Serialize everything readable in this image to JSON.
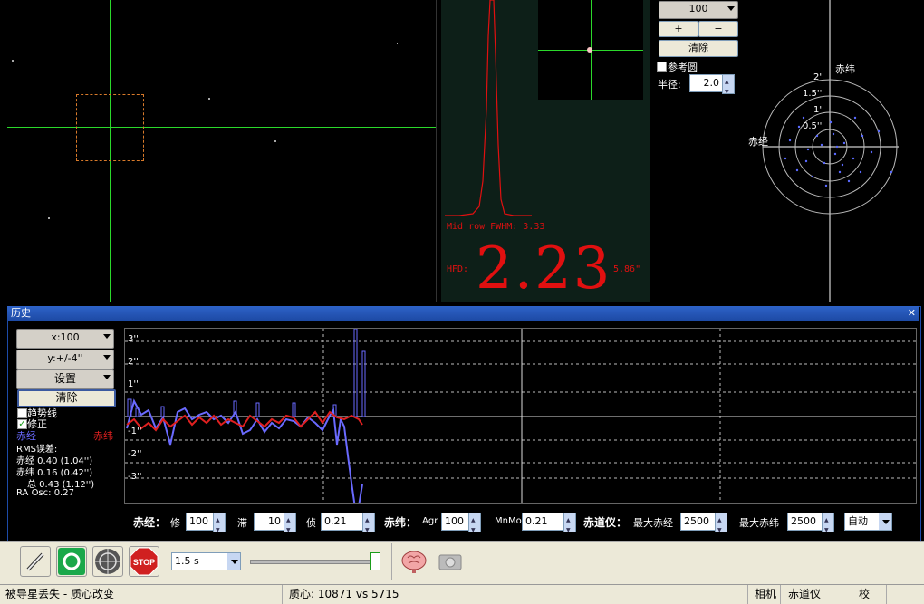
{
  "profile": {
    "fwhm_text": "Mid row FWHM: 3.33",
    "hfd_label": "HFD:",
    "hfd_value": "2.23",
    "hfd_arcsec": "5.86\""
  },
  "scatter": {
    "zoom_value": "100",
    "plus_label": "+",
    "minus_label": "−",
    "clear_label": "清除",
    "ref_circle_label": "参考圆",
    "radius_label": "半径:",
    "radius_value": "2.0",
    "axis_dec": "赤纬",
    "axis_ra": "赤经",
    "ring_labels": [
      "2''",
      "1.5''",
      "1''",
      "0.5''"
    ]
  },
  "history": {
    "title": "历史",
    "x_scale": "x:100",
    "y_scale": "y:+/-4''",
    "settings_label": "设置",
    "clear_label": "清除",
    "trendline_label": "趋势线",
    "correction_label": "修正",
    "ra_legend": "赤经",
    "dec_legend": "赤纬",
    "rms_title": "RMS误差:",
    "rms_ra": "赤经 0.40 (1.04'')",
    "rms_dec": "赤纬 0.16 (0.42'')",
    "rms_total": "总 0.43 (1.12'')",
    "ra_osc": "RA Osc: 0.27",
    "y_ticks": [
      "3''",
      "2''",
      "1''",
      "-1''",
      "-2''",
      "-3''"
    ]
  },
  "controls": {
    "ra_label": "赤经：",
    "ra_agg_label": "修",
    "ra_agg_value": "100",
    "ra_hys_label": "滞",
    "ra_hys_value": "10",
    "ra_min_label": "侦",
    "ra_min_value": "0.21",
    "dec_label": "赤纬：",
    "dec_agr_label": "Agr",
    "dec_agr_value": "100",
    "dec_minmo_label": "MnMo",
    "dec_minmo_value": "0.21",
    "mount_label": "赤道仪：",
    "max_ra_label": "最大赤经",
    "max_ra_value": "2500",
    "max_dec_label": "最大赤纬",
    "max_dec_value": "2500",
    "mode_value": "自动"
  },
  "toolbar": {
    "exposure_value": "1.5 s"
  },
  "status": {
    "message": "被导星丢失 - 质心改变",
    "centroid": "质心: 10871 vs 5715",
    "camera": "相机",
    "mount": "赤道仪",
    "cal": "校"
  },
  "colors": {
    "ra_series": "#6a6aff",
    "dec_series": "#e02020",
    "crosshair": "#2bd92b",
    "profile_red": "#e01010"
  }
}
